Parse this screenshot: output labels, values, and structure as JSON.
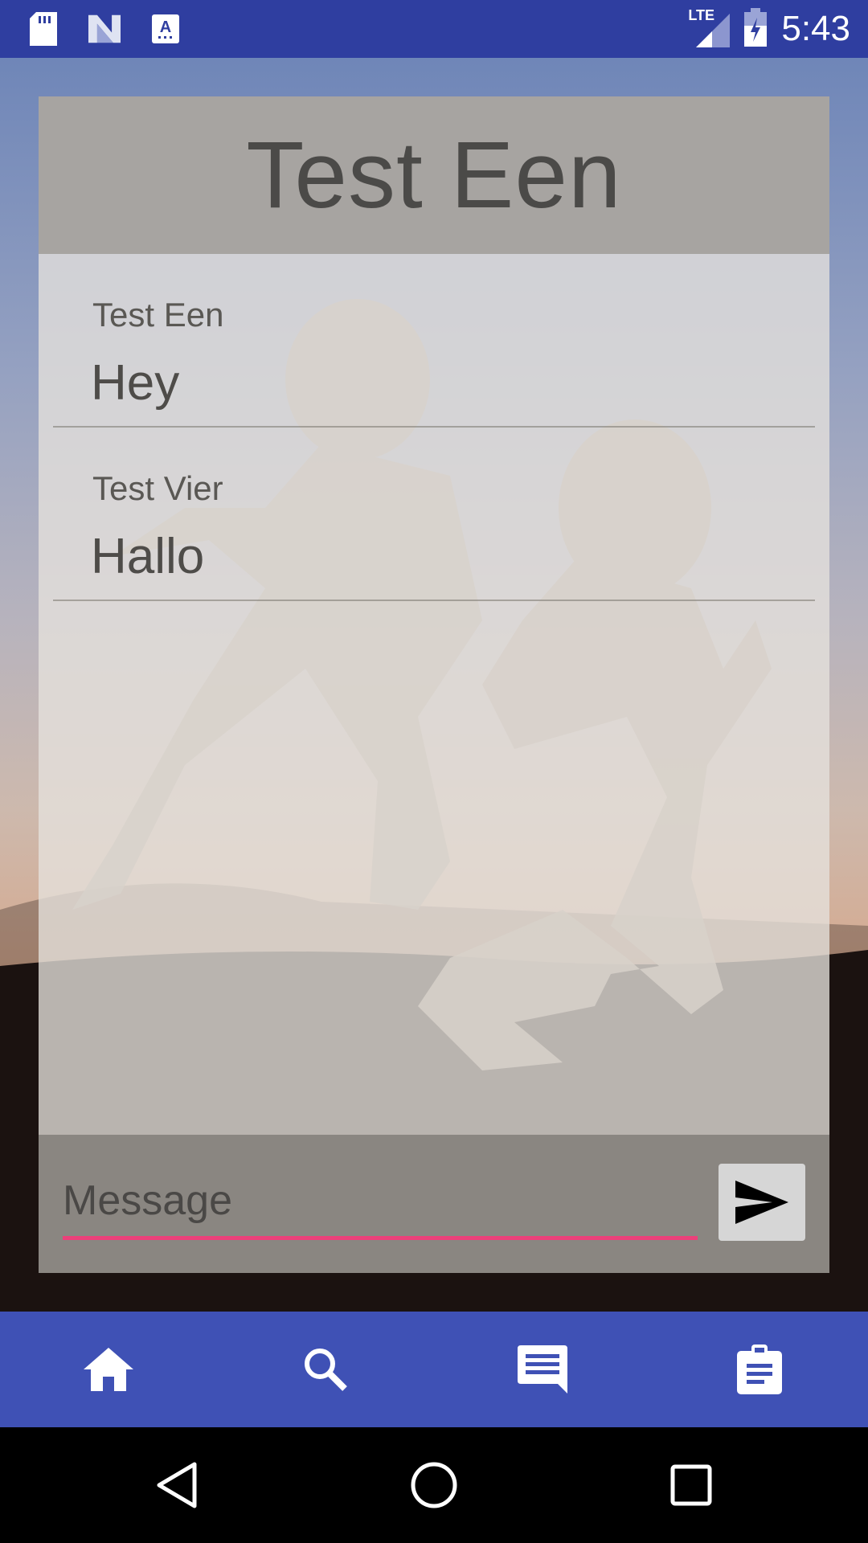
{
  "status_bar": {
    "time": "5:43",
    "network": "LTE",
    "icons": [
      "sd-card-icon",
      "n-logo-icon",
      "keyboard-a-icon",
      "signal-icon",
      "battery-charging-icon"
    ]
  },
  "conversation": {
    "title": "Test Een",
    "messages": [
      {
        "sender": "Test Een",
        "text": "Hey"
      },
      {
        "sender": "Test Vier",
        "text": "Hallo"
      }
    ]
  },
  "composer": {
    "placeholder": "Message",
    "send_icon": "send-icon",
    "accent_color": "#ec407a"
  },
  "bottom_nav": {
    "items": [
      "home-icon",
      "search-icon",
      "chat-icon",
      "assignment-icon"
    ],
    "background": "#3f51b5"
  },
  "system_nav": {
    "buttons": [
      "back-icon",
      "home-circle-icon",
      "recents-icon"
    ]
  }
}
